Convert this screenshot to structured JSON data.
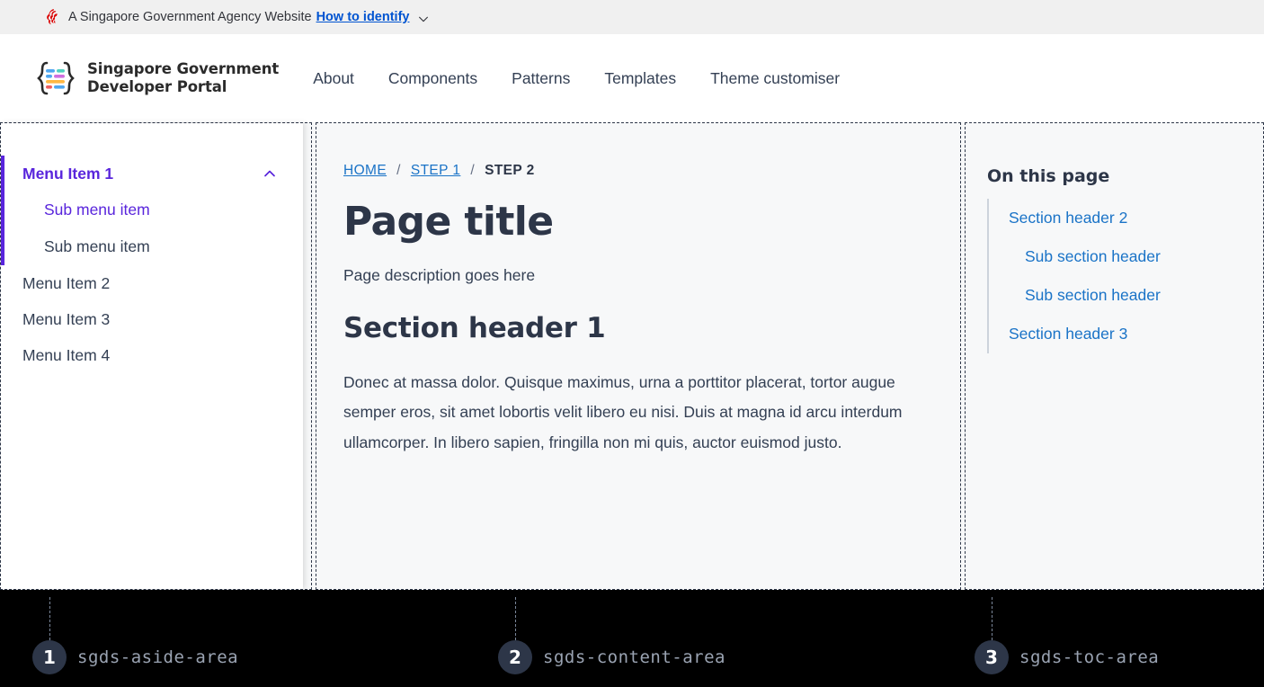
{
  "masthead": {
    "lion_icon": "singapore-lion-icon",
    "text": "A Singapore Government Agency Website",
    "link_label": "How to identify",
    "chevron_icon": "chevron-down-icon"
  },
  "navbar": {
    "logo_icon": "sgds-braces-logo-icon",
    "brand_line1": "Singapore Government",
    "brand_line2": "Developer Portal",
    "links": [
      {
        "label": "About"
      },
      {
        "label": "Components"
      },
      {
        "label": "Patterns"
      },
      {
        "label": "Templates"
      },
      {
        "label": "Theme customiser"
      }
    ]
  },
  "aside": {
    "accent_color": "#5925dc",
    "groups": [
      {
        "label": "Menu Item 1",
        "active": true,
        "chevron_icon": "chevron-up-icon",
        "children": [
          {
            "label": "Sub menu item",
            "active": true
          },
          {
            "label": "Sub menu item",
            "active": false
          }
        ]
      },
      {
        "label": "Menu Item 2",
        "active": false,
        "children": []
      },
      {
        "label": "Menu Item 3",
        "active": false,
        "children": []
      },
      {
        "label": "Menu Item 4",
        "active": false,
        "children": []
      }
    ]
  },
  "content": {
    "breadcrumb": [
      {
        "label": "HOME",
        "current": false
      },
      {
        "label": "STEP 1",
        "current": false
      },
      {
        "label": "STEP 2",
        "current": true
      }
    ],
    "breadcrumb_separator": "/",
    "title": "Page title",
    "description": "Page description goes here",
    "section_header": "Section header 1",
    "body": "Donec at massa dolor. Quisque maximus, urna a porttitor placerat, tortor augue semper eros, sit amet lobortis velit libero eu nisi. Duis at magna id arcu interdum ullamcorper. In libero sapien, fringilla non mi quis, auctor euismod justo."
  },
  "toc": {
    "title": "On this page",
    "link_color": "#1a73c7",
    "items": [
      {
        "label": "Section header 2",
        "level": 1
      },
      {
        "label": "Sub section header",
        "level": 2
      },
      {
        "label": "Sub section header",
        "level": 2
      },
      {
        "label": "Section header 3",
        "level": 1
      }
    ]
  },
  "callouts": [
    {
      "number": "1",
      "label": "sgds-aside-area"
    },
    {
      "number": "2",
      "label": "sgds-content-area"
    },
    {
      "number": "3",
      "label": "sgds-toc-area"
    }
  ]
}
